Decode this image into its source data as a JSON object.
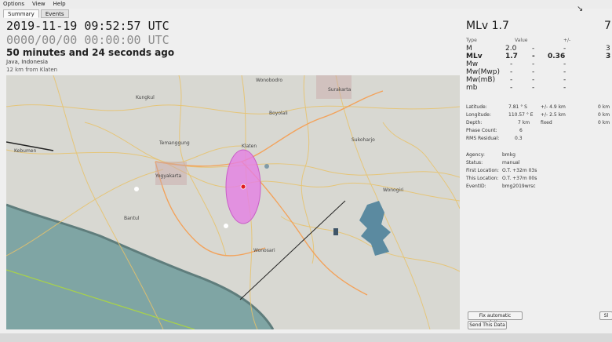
{
  "menu": [
    "Options",
    "View",
    "Help"
  ],
  "tabs": [
    "Summary",
    "Events"
  ],
  "origin": {
    "time": "2019-11-19 09:52:57 UTC",
    "zero_time": "0000/00/00  00:00:00 UTC",
    "ago": "50 minutes and 24 seconds ago",
    "region": "Java, Indonesia",
    "distance": "12 km from Klaten"
  },
  "magnitude": {
    "title": "MLv 1.7",
    "right_value": "7",
    "headers": [
      "Type",
      "Value",
      "+/-"
    ],
    "rows": [
      {
        "type": "M",
        "value": "2.0",
        "unc": "-",
        "extra": "3"
      },
      {
        "type": "MLv",
        "value": "1.7",
        "unc": "0.36",
        "extra": "3"
      },
      {
        "type": "Mw",
        "value": "-",
        "unc": "-",
        "extra": ""
      },
      {
        "type": "Mw(Mwp)",
        "value": "-",
        "unc": "-",
        "extra": ""
      },
      {
        "type": "Mw(mB)",
        "value": "-",
        "unc": "-",
        "extra": ""
      },
      {
        "type": "mb",
        "value": "-",
        "unc": "-",
        "extra": ""
      }
    ]
  },
  "location": [
    {
      "label": "Latitude:",
      "value": "7.81 ° S",
      "unc": "+/- 4.9 km",
      "extra": "0 km"
    },
    {
      "label": "Longitude:",
      "value": "110.57 ° E",
      "unc": "+/- 2.5 km",
      "extra": "0 km"
    },
    {
      "label": "Depth:",
      "value": "7 km",
      "unc": "fixed",
      "extra": "0 km"
    },
    {
      "label": "Phase Count:",
      "value": "6",
      "unc": "",
      "extra": ""
    },
    {
      "label": "RMS Residual:",
      "value": "0.3",
      "unc": "",
      "extra": ""
    }
  ],
  "meta": [
    {
      "label": "Agency:",
      "value": "bmkg"
    },
    {
      "label": "Status:",
      "value": "manual"
    },
    {
      "label": "First Location:",
      "value": "O.T. +32m 03s"
    },
    {
      "label": "This Location:",
      "value": "O.T. +37m 00s"
    },
    {
      "label": "EventID:",
      "value": "bmg2019wrsc"
    }
  ],
  "buttons": {
    "fix_solution": "Fix automatic solutions",
    "send_data": "Send This Data",
    "right_cut": "Sl"
  },
  "map": {
    "places": [
      "Kungkul",
      "Wonobodro",
      "Boyolali",
      "Surakarta",
      "Temanggung",
      "Kebumen",
      "Klaten",
      "Sukoharjo",
      "Yogyakarta",
      "Bantul",
      "Wonosari",
      "Wonogiri"
    ],
    "colors": {
      "ellipse": "#e57fe3",
      "epicenter": "#e01c1c",
      "sea": "#7fa5a4",
      "land": "#d8d8d2",
      "reservoir": "#5b8aa0"
    }
  }
}
